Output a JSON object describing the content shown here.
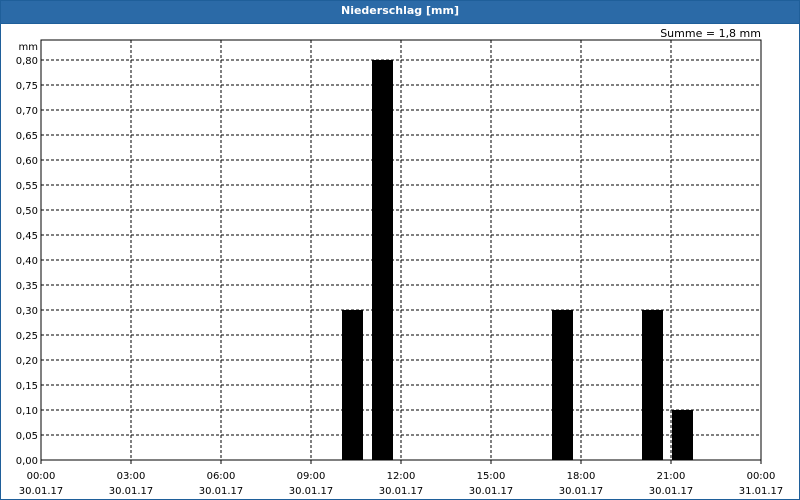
{
  "window": {
    "title": "Niederschlag [mm]"
  },
  "summary": {
    "text": "Summe = 1,8 mm"
  },
  "chart_data": {
    "type": "bar",
    "title": "Niederschlag [mm]",
    "ylabel": "mm",
    "ylim": [
      0,
      0.8
    ],
    "ytick_step": 0.05,
    "yticks": [
      "0,00",
      "0,05",
      "0,10",
      "0,15",
      "0,20",
      "0,25",
      "0,30",
      "0,35",
      "0,40",
      "0,45",
      "0,50",
      "0,55",
      "0,60",
      "0,65",
      "0,70",
      "0,75",
      "0,80"
    ],
    "x_range_hours": [
      0,
      24
    ],
    "xticks": [
      {
        "time": "00:00",
        "date": "30.01.17"
      },
      {
        "time": "03:00",
        "date": "30.01.17"
      },
      {
        "time": "06:00",
        "date": "30.01.17"
      },
      {
        "time": "09:00",
        "date": "30.01.17"
      },
      {
        "time": "12:00",
        "date": "30.01.17"
      },
      {
        "time": "15:00",
        "date": "30.01.17"
      },
      {
        "time": "18:00",
        "date": "30.01.17"
      },
      {
        "time": "21:00",
        "date": "30.01.17"
      },
      {
        "time": "00:00",
        "date": "31.01.17"
      }
    ],
    "bars": [
      {
        "start": "30.01.17 10:00",
        "end": "30.01.17 11:00",
        "value": 0.3
      },
      {
        "start": "30.01.17 11:00",
        "end": "30.01.17 12:00",
        "value": 0.8
      },
      {
        "start": "30.01.17 17:00",
        "end": "30.01.17 18:00",
        "value": 0.3
      },
      {
        "start": "30.01.17 20:00",
        "end": "30.01.17 21:00",
        "value": 0.3
      },
      {
        "start": "30.01.17 21:00",
        "end": "30.01.17 22:00",
        "value": 0.1
      }
    ],
    "grid": true,
    "colors": {
      "bar": "#000000",
      "titlebar": "#2b6aa7"
    }
  }
}
